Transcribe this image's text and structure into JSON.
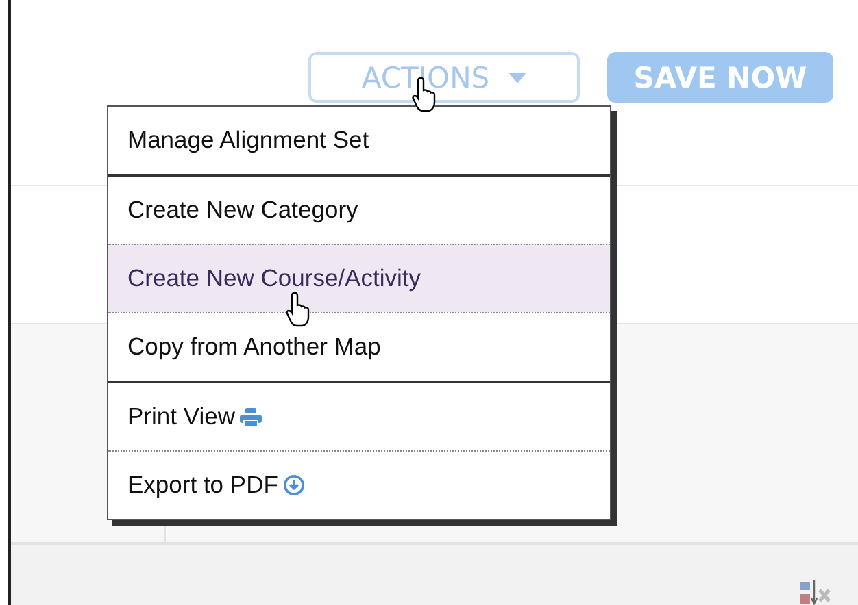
{
  "toolbar": {
    "actions_button": {
      "label": "ACTIONS",
      "expanded": true
    },
    "save_button": {
      "label": "SAVE NOW"
    }
  },
  "menu": {
    "groups": [
      [
        {
          "label": "Manage Alignment Set",
          "selected": false,
          "kind": "plain"
        }
      ],
      [
        {
          "label": "Create New Category",
          "selected": false,
          "kind": "plain"
        },
        {
          "label": "Create New Course/Activity",
          "selected": true,
          "kind": "plain"
        },
        {
          "label": "Copy from Another Map",
          "selected": false,
          "kind": "plain"
        }
      ],
      [
        {
          "label": "Print View",
          "selected": false,
          "kind": "print"
        },
        {
          "label": "Export to PDF",
          "selected": false,
          "kind": "export"
        }
      ]
    ]
  }
}
